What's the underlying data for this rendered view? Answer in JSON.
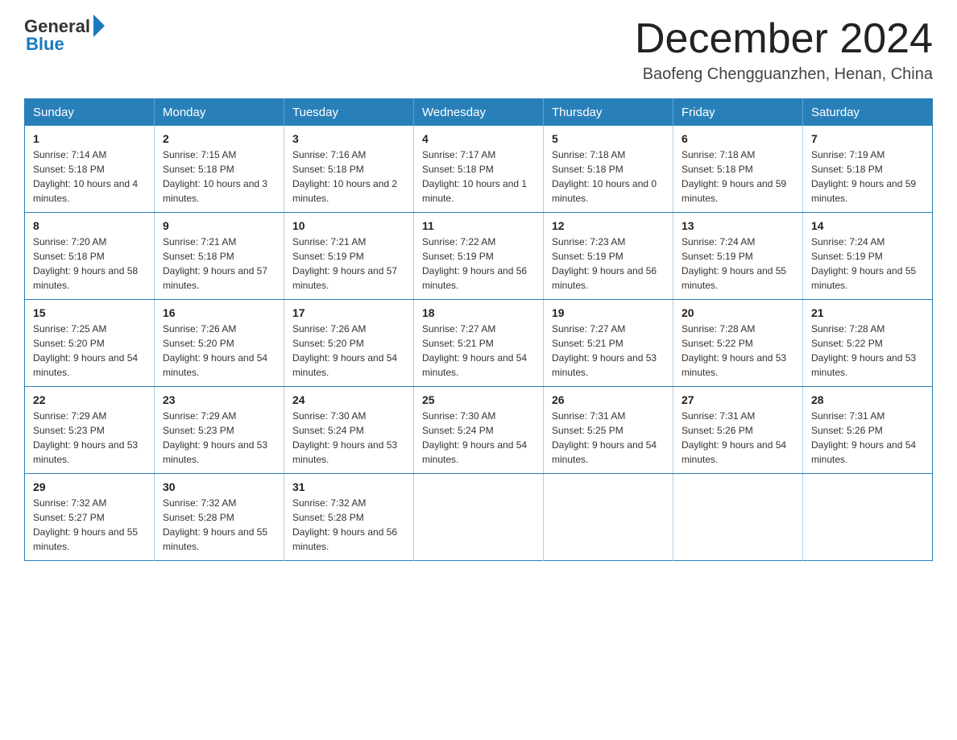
{
  "logo": {
    "general": "General",
    "blue": "Blue"
  },
  "title": "December 2024",
  "location": "Baofeng Chengguanzhen, Henan, China",
  "days_of_week": [
    "Sunday",
    "Monday",
    "Tuesday",
    "Wednesday",
    "Thursday",
    "Friday",
    "Saturday"
  ],
  "weeks": [
    [
      {
        "day": "1",
        "sunrise": "7:14 AM",
        "sunset": "5:18 PM",
        "daylight": "10 hours and 4 minutes."
      },
      {
        "day": "2",
        "sunrise": "7:15 AM",
        "sunset": "5:18 PM",
        "daylight": "10 hours and 3 minutes."
      },
      {
        "day": "3",
        "sunrise": "7:16 AM",
        "sunset": "5:18 PM",
        "daylight": "10 hours and 2 minutes."
      },
      {
        "day": "4",
        "sunrise": "7:17 AM",
        "sunset": "5:18 PM",
        "daylight": "10 hours and 1 minute."
      },
      {
        "day": "5",
        "sunrise": "7:18 AM",
        "sunset": "5:18 PM",
        "daylight": "10 hours and 0 minutes."
      },
      {
        "day": "6",
        "sunrise": "7:18 AM",
        "sunset": "5:18 PM",
        "daylight": "9 hours and 59 minutes."
      },
      {
        "day": "7",
        "sunrise": "7:19 AM",
        "sunset": "5:18 PM",
        "daylight": "9 hours and 59 minutes."
      }
    ],
    [
      {
        "day": "8",
        "sunrise": "7:20 AM",
        "sunset": "5:18 PM",
        "daylight": "9 hours and 58 minutes."
      },
      {
        "day": "9",
        "sunrise": "7:21 AM",
        "sunset": "5:18 PM",
        "daylight": "9 hours and 57 minutes."
      },
      {
        "day": "10",
        "sunrise": "7:21 AM",
        "sunset": "5:19 PM",
        "daylight": "9 hours and 57 minutes."
      },
      {
        "day": "11",
        "sunrise": "7:22 AM",
        "sunset": "5:19 PM",
        "daylight": "9 hours and 56 minutes."
      },
      {
        "day": "12",
        "sunrise": "7:23 AM",
        "sunset": "5:19 PM",
        "daylight": "9 hours and 56 minutes."
      },
      {
        "day": "13",
        "sunrise": "7:24 AM",
        "sunset": "5:19 PM",
        "daylight": "9 hours and 55 minutes."
      },
      {
        "day": "14",
        "sunrise": "7:24 AM",
        "sunset": "5:19 PM",
        "daylight": "9 hours and 55 minutes."
      }
    ],
    [
      {
        "day": "15",
        "sunrise": "7:25 AM",
        "sunset": "5:20 PM",
        "daylight": "9 hours and 54 minutes."
      },
      {
        "day": "16",
        "sunrise": "7:26 AM",
        "sunset": "5:20 PM",
        "daylight": "9 hours and 54 minutes."
      },
      {
        "day": "17",
        "sunrise": "7:26 AM",
        "sunset": "5:20 PM",
        "daylight": "9 hours and 54 minutes."
      },
      {
        "day": "18",
        "sunrise": "7:27 AM",
        "sunset": "5:21 PM",
        "daylight": "9 hours and 54 minutes."
      },
      {
        "day": "19",
        "sunrise": "7:27 AM",
        "sunset": "5:21 PM",
        "daylight": "9 hours and 53 minutes."
      },
      {
        "day": "20",
        "sunrise": "7:28 AM",
        "sunset": "5:22 PM",
        "daylight": "9 hours and 53 minutes."
      },
      {
        "day": "21",
        "sunrise": "7:28 AM",
        "sunset": "5:22 PM",
        "daylight": "9 hours and 53 minutes."
      }
    ],
    [
      {
        "day": "22",
        "sunrise": "7:29 AM",
        "sunset": "5:23 PM",
        "daylight": "9 hours and 53 minutes."
      },
      {
        "day": "23",
        "sunrise": "7:29 AM",
        "sunset": "5:23 PM",
        "daylight": "9 hours and 53 minutes."
      },
      {
        "day": "24",
        "sunrise": "7:30 AM",
        "sunset": "5:24 PM",
        "daylight": "9 hours and 53 minutes."
      },
      {
        "day": "25",
        "sunrise": "7:30 AM",
        "sunset": "5:24 PM",
        "daylight": "9 hours and 54 minutes."
      },
      {
        "day": "26",
        "sunrise": "7:31 AM",
        "sunset": "5:25 PM",
        "daylight": "9 hours and 54 minutes."
      },
      {
        "day": "27",
        "sunrise": "7:31 AM",
        "sunset": "5:26 PM",
        "daylight": "9 hours and 54 minutes."
      },
      {
        "day": "28",
        "sunrise": "7:31 AM",
        "sunset": "5:26 PM",
        "daylight": "9 hours and 54 minutes."
      }
    ],
    [
      {
        "day": "29",
        "sunrise": "7:32 AM",
        "sunset": "5:27 PM",
        "daylight": "9 hours and 55 minutes."
      },
      {
        "day": "30",
        "sunrise": "7:32 AM",
        "sunset": "5:28 PM",
        "daylight": "9 hours and 55 minutes."
      },
      {
        "day": "31",
        "sunrise": "7:32 AM",
        "sunset": "5:28 PM",
        "daylight": "9 hours and 56 minutes."
      },
      null,
      null,
      null,
      null
    ]
  ]
}
